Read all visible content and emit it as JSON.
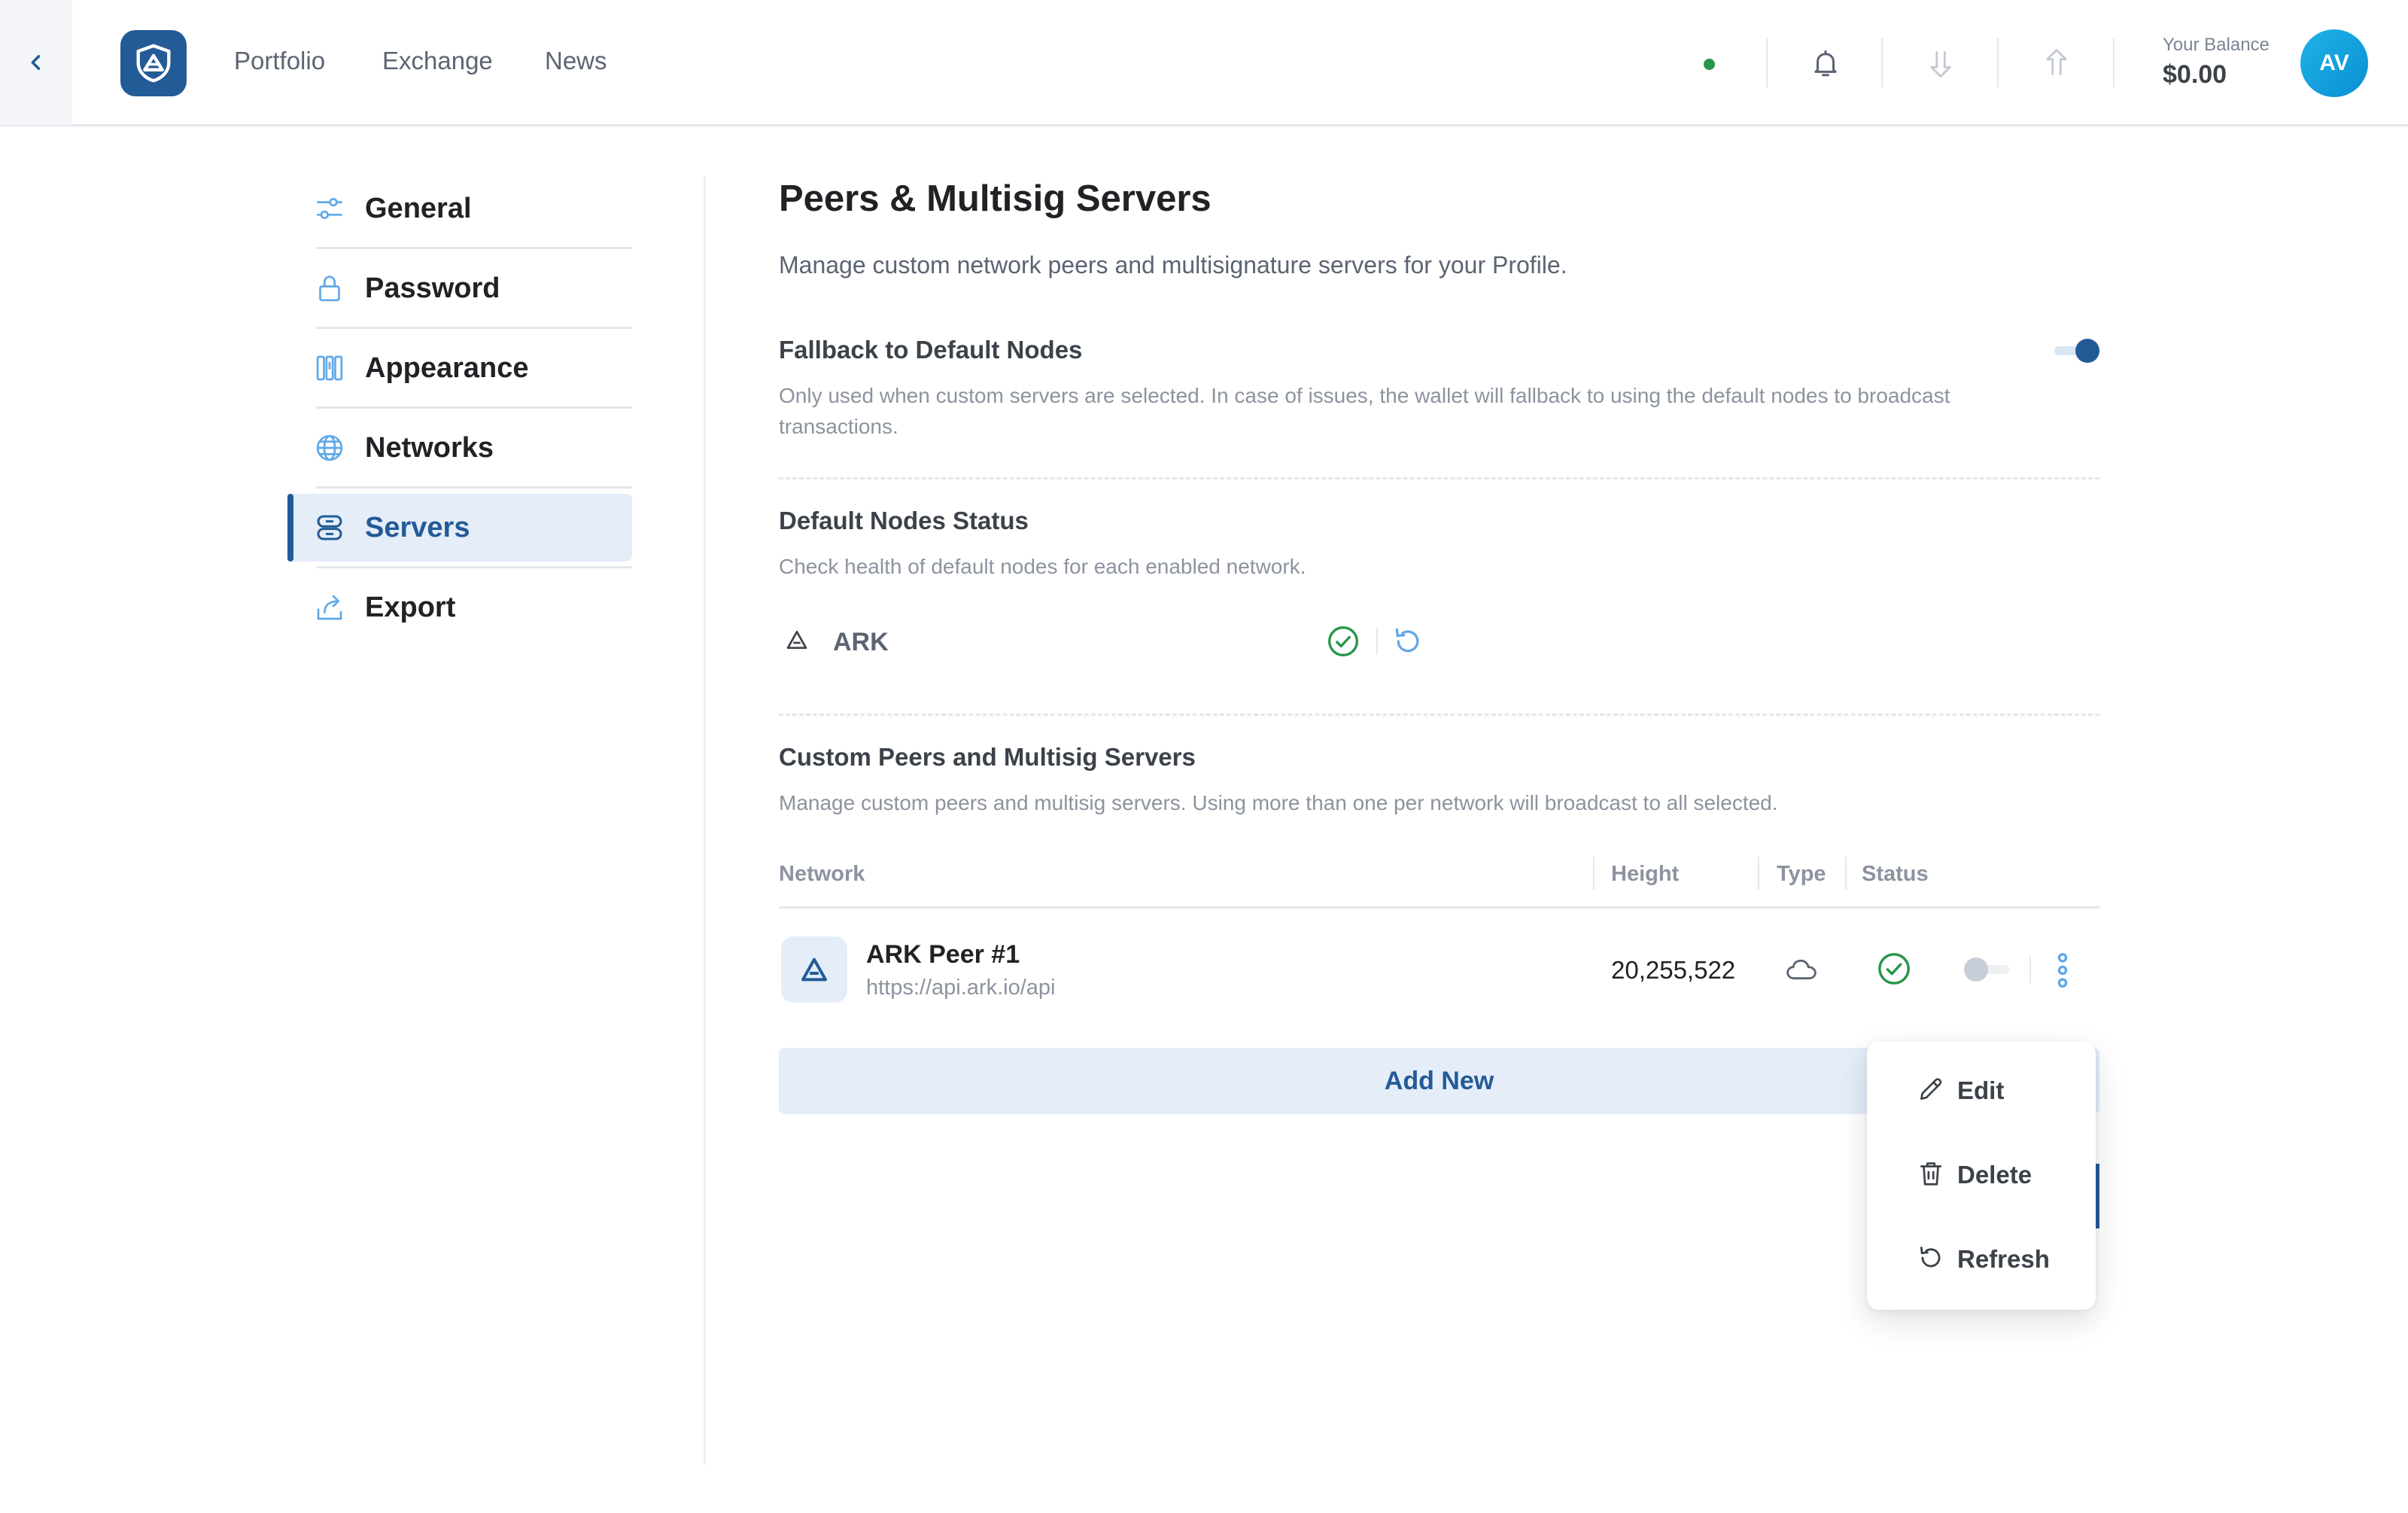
{
  "header": {
    "nav": [
      "Portfolio",
      "Exchange",
      "News"
    ],
    "balance_label": "Your Balance",
    "balance_value": "$0.00",
    "avatar_initials": "AV",
    "connection_status_color": "#289548"
  },
  "sidebar": {
    "items": [
      {
        "label": "General",
        "icon": "sliders-icon"
      },
      {
        "label": "Password",
        "icon": "lock-icon"
      },
      {
        "label": "Appearance",
        "icon": "appearance-icon"
      },
      {
        "label": "Networks",
        "icon": "globe-icon"
      },
      {
        "label": "Servers",
        "icon": "server-icon",
        "active": true
      },
      {
        "label": "Export",
        "icon": "export-icon"
      }
    ]
  },
  "main": {
    "title": "Peers & Multisig Servers",
    "description": "Manage custom network peers and multisignature servers for your Profile.",
    "fallback": {
      "title": "Fallback to Default Nodes",
      "description": "Only used when custom servers are selected. In case of issues, the wallet will fallback to using the default nodes to broadcast transactions.",
      "enabled": true
    },
    "default_nodes": {
      "title": "Default Nodes Status",
      "description": "Check health of default nodes for each enabled network.",
      "networks": [
        {
          "name": "ARK",
          "status": "healthy"
        }
      ]
    },
    "custom": {
      "title": "Custom Peers and Multisig Servers",
      "description": "Manage custom peers and multisig servers. Using more than one per network will broadcast to all selected.",
      "columns": [
        "Network",
        "Height",
        "Type",
        "Status"
      ],
      "rows": [
        {
          "name": "ARK Peer #1",
          "url": "https://api.ark.io/api",
          "height": "20,255,522",
          "type": "cloud-icon",
          "status": "healthy",
          "enabled": false
        }
      ],
      "add_label": "Add New"
    },
    "dropdown": [
      "Edit",
      "Delete",
      "Refresh"
    ]
  },
  "colors": {
    "primary": "#235b97",
    "primary_light": "#e4edf8",
    "success": "#289548",
    "accent_light_blue": "#5fa8e8"
  }
}
